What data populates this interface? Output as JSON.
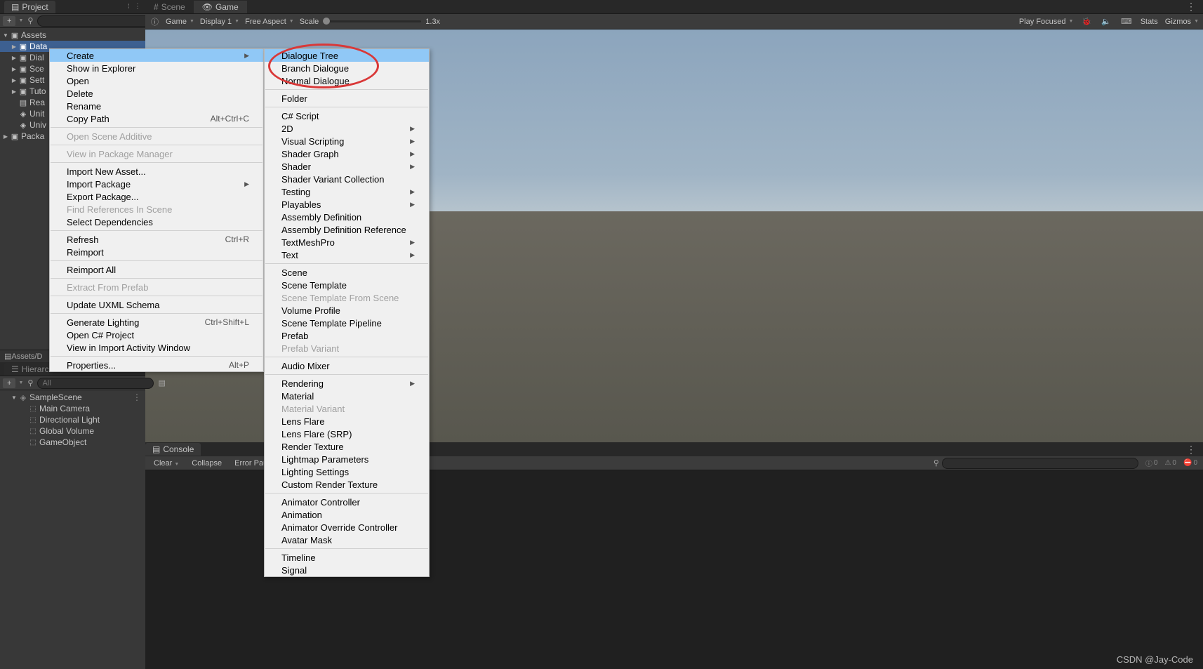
{
  "project_panel": {
    "tab": "Project",
    "toolbar": {
      "add": "+",
      "search_placeholder": ""
    },
    "tree": [
      {
        "label": "Assets",
        "icon": "folder",
        "expanded": true,
        "indent": 0
      },
      {
        "label": "Data",
        "icon": "folder",
        "selected": true,
        "indent": 1
      },
      {
        "label": "Dial",
        "icon": "folder",
        "indent": 1
      },
      {
        "label": "Sce",
        "icon": "folder",
        "indent": 1
      },
      {
        "label": "Sett",
        "icon": "folder",
        "indent": 1
      },
      {
        "label": "Tuto",
        "icon": "folder",
        "indent": 1
      },
      {
        "label": "Rea",
        "icon": "doc",
        "indent": 1
      },
      {
        "label": "Unit",
        "icon": "unity",
        "indent": 1
      },
      {
        "label": "Univ",
        "icon": "unity",
        "indent": 1
      },
      {
        "label": "Packa",
        "icon": "folder",
        "indent": 0
      }
    ],
    "breadcrumb": "Assets/D"
  },
  "hierarchy_panel": {
    "tab": "Hierarch",
    "toolbar": {
      "add": "+",
      "search_placeholder": "All"
    },
    "scene": "SampleScene",
    "items": [
      {
        "label": "Main Camera"
      },
      {
        "label": "Directional Light"
      },
      {
        "label": "Global Volume"
      },
      {
        "label": "GameObject"
      }
    ]
  },
  "game_tabs": {
    "scene": "Scene",
    "game": "Game"
  },
  "game_toolbar": {
    "mode": "Game",
    "display": "Display 1",
    "aspect": "Free Aspect",
    "scale_label": "Scale",
    "scale_value": "1.3x",
    "play_mode": "Play Focused",
    "stats": "Stats",
    "gizmos": "Gizmos"
  },
  "console": {
    "tab": "Console",
    "clear": "Clear",
    "collapse": "Collapse",
    "error_pause": "Error Pau",
    "info_count": "0",
    "warn_count": "0",
    "error_count": "0"
  },
  "context_menu_1": [
    {
      "label": "Create",
      "submenu": true,
      "highlighted": true
    },
    {
      "label": "Show in Explorer"
    },
    {
      "label": "Open"
    },
    {
      "label": "Delete"
    },
    {
      "label": "Rename"
    },
    {
      "label": "Copy Path",
      "shortcut": "Alt+Ctrl+C"
    },
    {
      "sep": true
    },
    {
      "label": "Open Scene Additive",
      "disabled": true
    },
    {
      "sep": true
    },
    {
      "label": "View in Package Manager",
      "disabled": true
    },
    {
      "sep": true
    },
    {
      "label": "Import New Asset..."
    },
    {
      "label": "Import Package",
      "submenu": true
    },
    {
      "label": "Export Package..."
    },
    {
      "label": "Find References In Scene",
      "disabled": true
    },
    {
      "label": "Select Dependencies"
    },
    {
      "sep": true
    },
    {
      "label": "Refresh",
      "shortcut": "Ctrl+R"
    },
    {
      "label": "Reimport"
    },
    {
      "sep": true
    },
    {
      "label": "Reimport All"
    },
    {
      "sep": true
    },
    {
      "label": "Extract From Prefab",
      "disabled": true
    },
    {
      "sep": true
    },
    {
      "label": "Update UXML Schema"
    },
    {
      "sep": true
    },
    {
      "label": "Generate Lighting",
      "shortcut": "Ctrl+Shift+L"
    },
    {
      "label": "Open C# Project"
    },
    {
      "label": "View in Import Activity Window"
    },
    {
      "sep": true
    },
    {
      "label": "Properties...",
      "shortcut": "Alt+P"
    }
  ],
  "context_menu_2": [
    {
      "label": "Dialogue Tree",
      "highlighted": true
    },
    {
      "label": "Branch Dialogue"
    },
    {
      "label": "Normal Dialogue"
    },
    {
      "sep": true
    },
    {
      "label": "Folder"
    },
    {
      "sep": true
    },
    {
      "label": "C# Script"
    },
    {
      "label": "2D",
      "submenu": true
    },
    {
      "label": "Visual Scripting",
      "submenu": true
    },
    {
      "label": "Shader Graph",
      "submenu": true
    },
    {
      "label": "Shader",
      "submenu": true
    },
    {
      "label": "Shader Variant Collection"
    },
    {
      "label": "Testing",
      "submenu": true
    },
    {
      "label": "Playables",
      "submenu": true
    },
    {
      "label": "Assembly Definition"
    },
    {
      "label": "Assembly Definition Reference"
    },
    {
      "label": "TextMeshPro",
      "submenu": true
    },
    {
      "label": "Text",
      "submenu": true
    },
    {
      "sep": true
    },
    {
      "label": "Scene"
    },
    {
      "label": "Scene Template"
    },
    {
      "label": "Scene Template From Scene",
      "disabled": true
    },
    {
      "label": "Volume Profile"
    },
    {
      "label": "Scene Template Pipeline"
    },
    {
      "label": "Prefab"
    },
    {
      "label": "Prefab Variant",
      "disabled": true
    },
    {
      "sep": true
    },
    {
      "label": "Audio Mixer"
    },
    {
      "sep": true
    },
    {
      "label": "Rendering",
      "submenu": true
    },
    {
      "label": "Material"
    },
    {
      "label": "Material Variant",
      "disabled": true
    },
    {
      "label": "Lens Flare"
    },
    {
      "label": "Lens Flare (SRP)"
    },
    {
      "label": "Render Texture"
    },
    {
      "label": "Lightmap Parameters"
    },
    {
      "label": "Lighting Settings"
    },
    {
      "label": "Custom Render Texture"
    },
    {
      "sep": true
    },
    {
      "label": "Animator Controller"
    },
    {
      "label": "Animation"
    },
    {
      "label": "Animator Override Controller"
    },
    {
      "label": "Avatar Mask"
    },
    {
      "sep": true
    },
    {
      "label": "Timeline"
    },
    {
      "label": "Signal"
    }
  ],
  "watermark": "CSDN @Jay-Code"
}
